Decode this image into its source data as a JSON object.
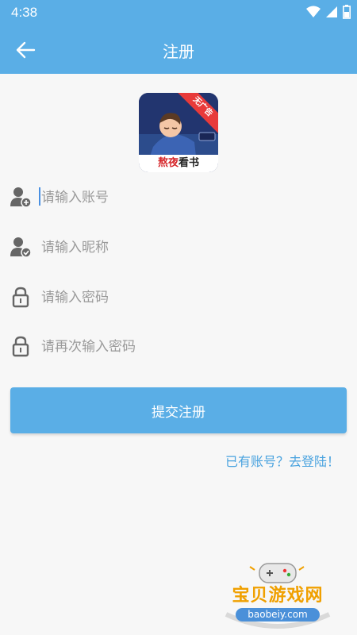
{
  "status_bar": {
    "time": "4:38"
  },
  "app_bar": {
    "title": "注册"
  },
  "logo": {
    "ribbon": "无广告",
    "name_red": "熬夜",
    "name_dark": "看书"
  },
  "form": {
    "account_placeholder": "请输入账号",
    "nickname_placeholder": "请输入昵称",
    "password_placeholder": "请输入密码",
    "password_confirm_placeholder": "请再次输入密码",
    "submit_label": "提交注册",
    "login_link": "已有账号？去登陆！"
  },
  "watermark": {
    "text": "宝贝游戏网",
    "url": "baobeiy.com"
  },
  "colors": {
    "primary": "#5aaee6",
    "link": "#4aa3df",
    "icon": "#666666"
  }
}
